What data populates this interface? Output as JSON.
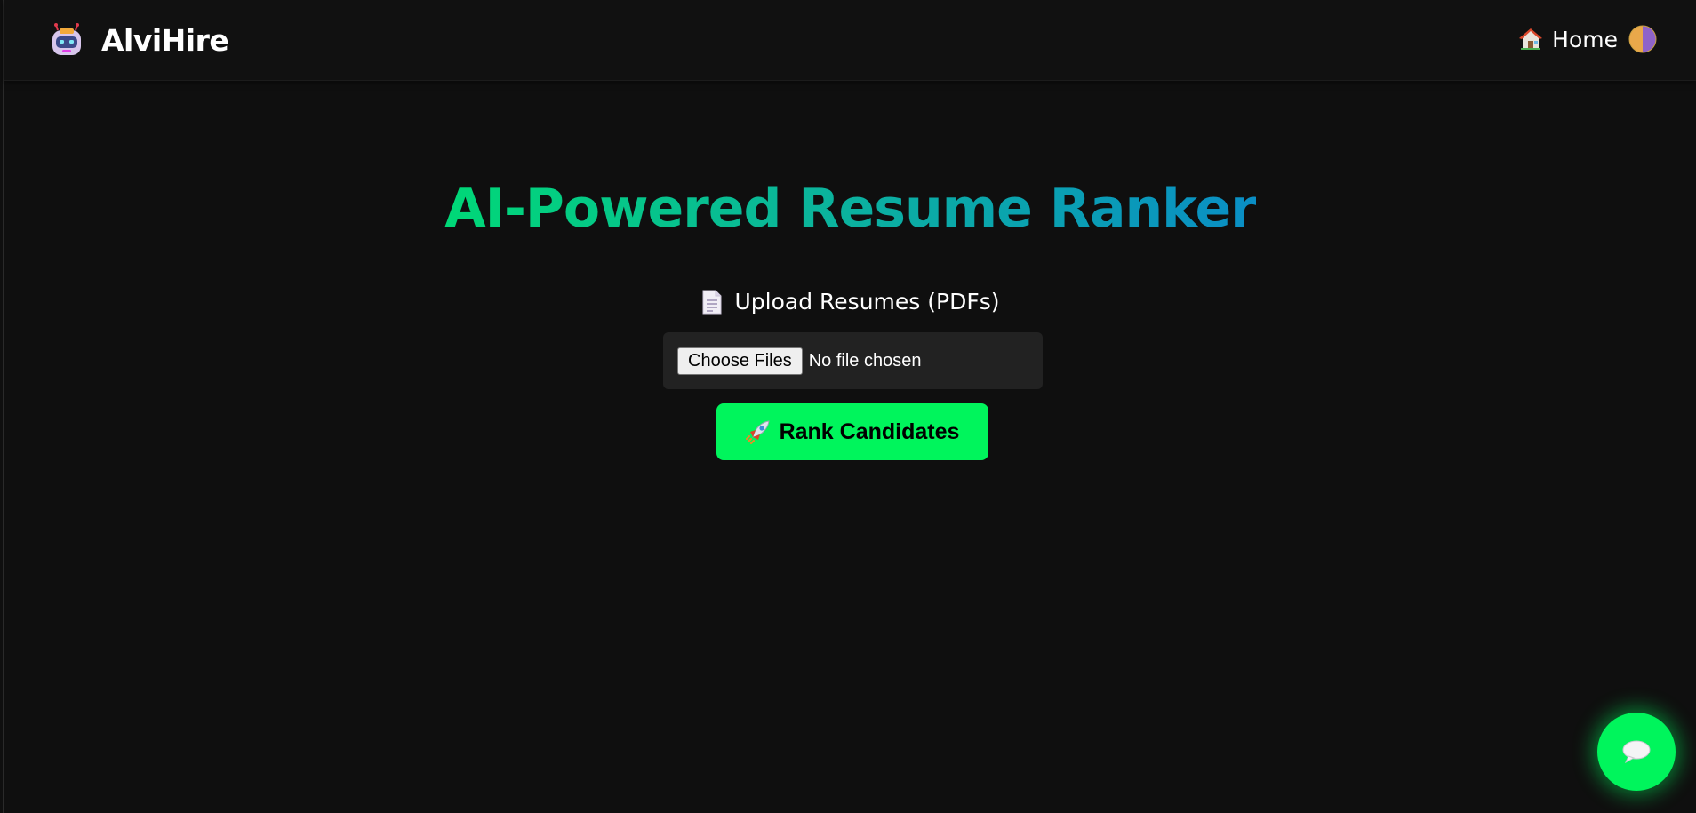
{
  "navbar": {
    "brand": "AlviHire",
    "brand_icon": "robot-icon",
    "home_label": "Home",
    "home_icon": "house-icon",
    "theme_icon": "theme-toggle-icon"
  },
  "hero": {
    "title": "AI-Powered Resume Ranker",
    "title_gradient": [
      "#00d877",
      "#0a8ec5"
    ]
  },
  "upload": {
    "label": "Upload Resumes (PDFs)",
    "label_icon": "document-icon",
    "choose_button": "Choose Files",
    "status": "No file chosen"
  },
  "action": {
    "rank_label": "Rank Candidates",
    "rank_icon": "rocket-icon",
    "color": "#00f55c"
  },
  "chat": {
    "icon": "speech-bubble-icon"
  }
}
